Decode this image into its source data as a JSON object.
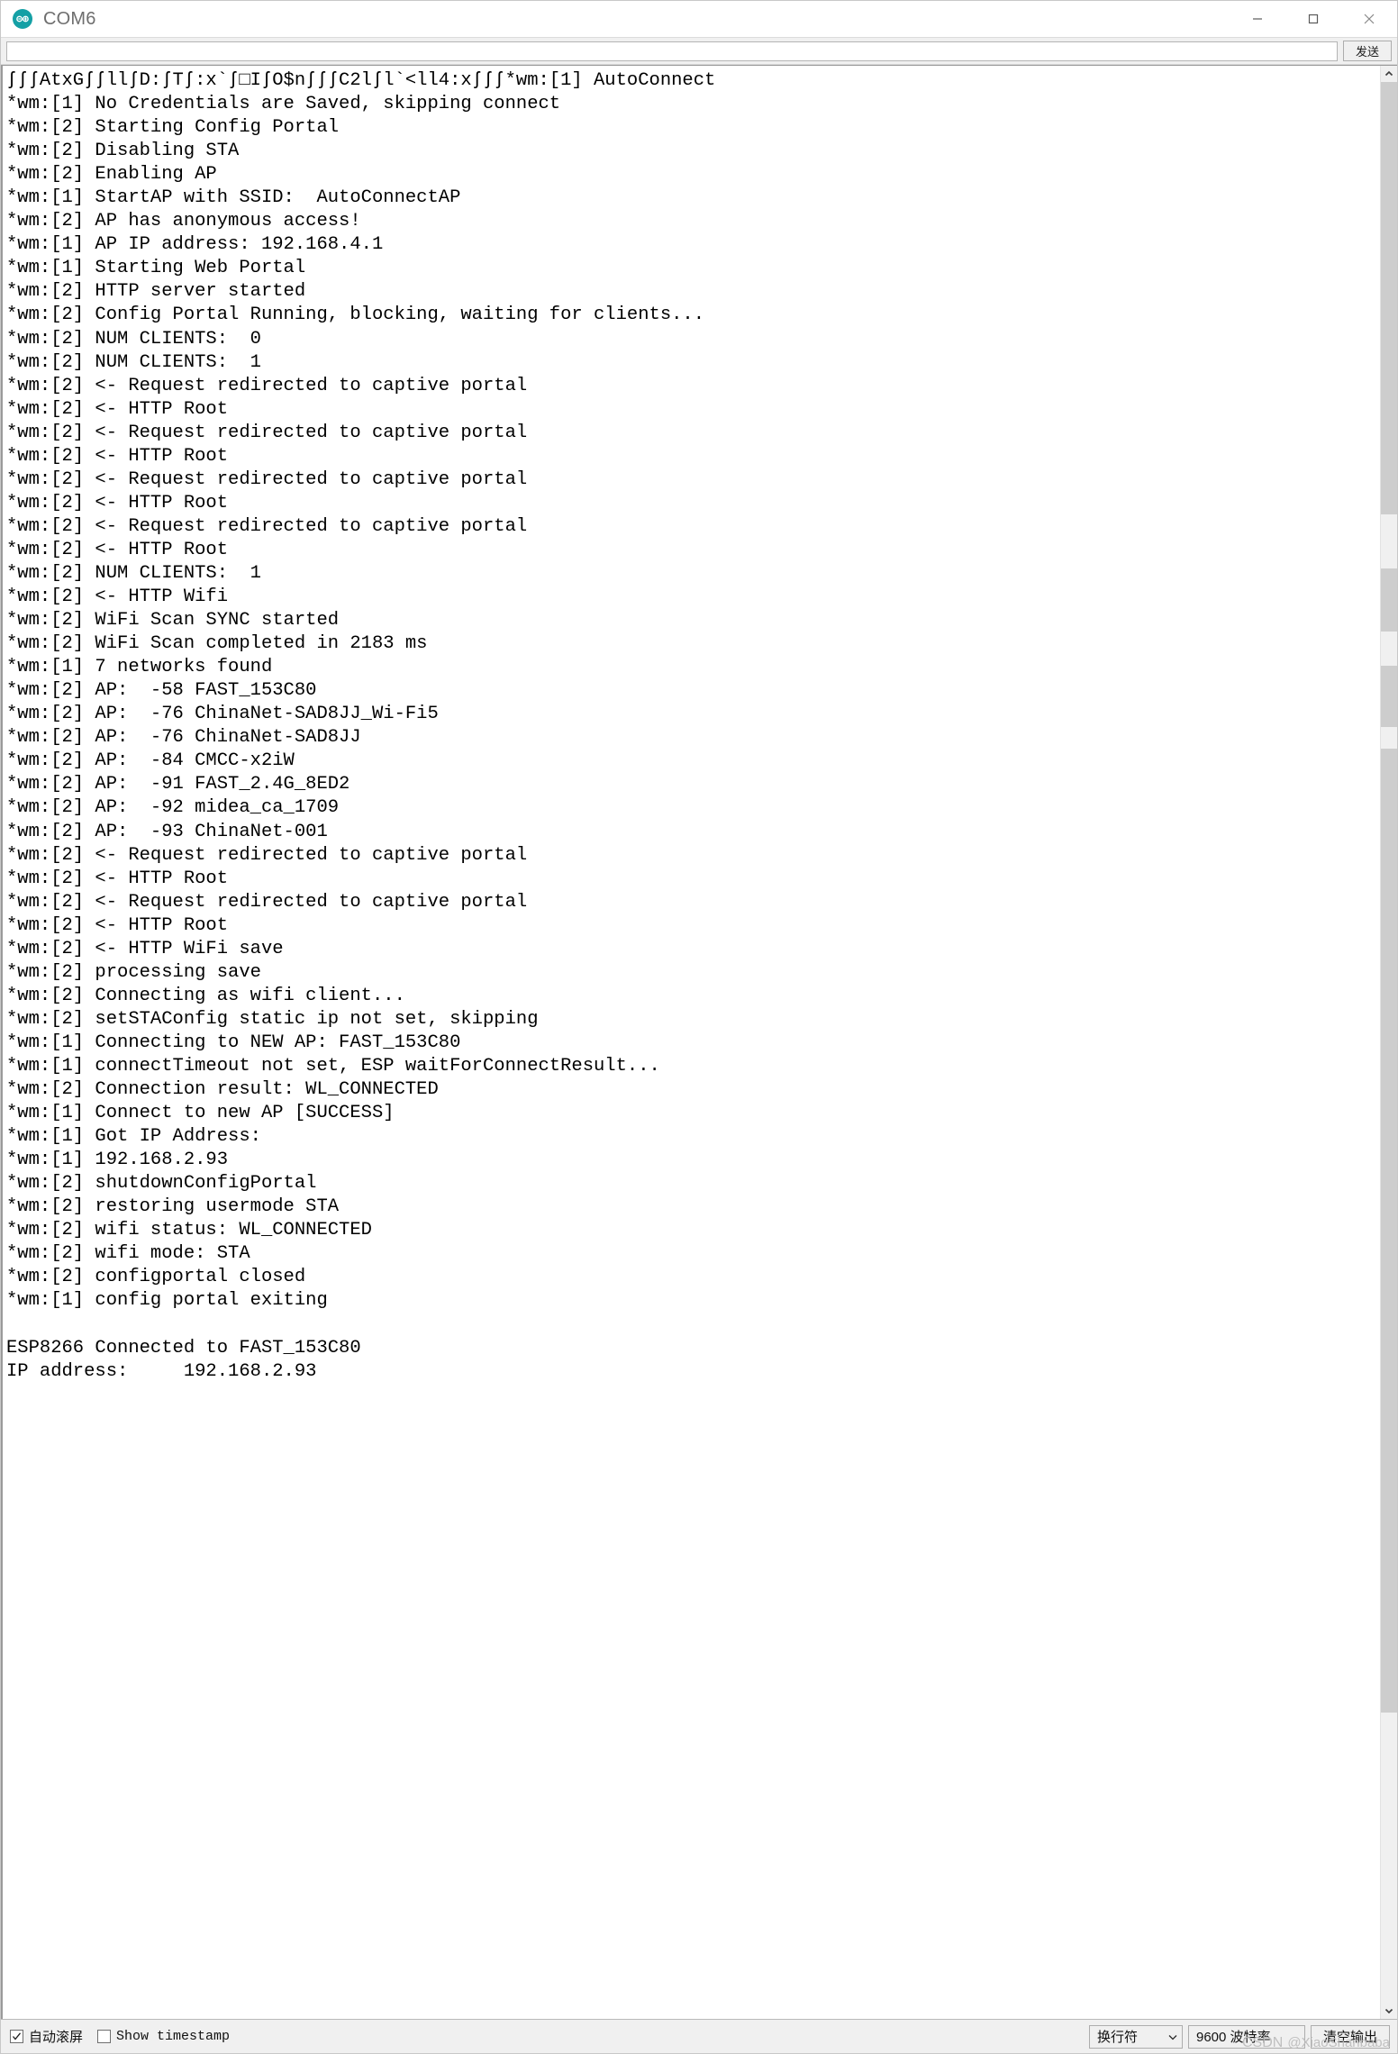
{
  "window": {
    "title": "COM6",
    "logo_icon": "arduino-logo-icon",
    "controls": [
      {
        "name": "minimize-button",
        "icon": "minimize-icon"
      },
      {
        "name": "maximize-button",
        "icon": "maximize-icon"
      },
      {
        "name": "close-button",
        "icon": "close-icon"
      }
    ]
  },
  "send_row": {
    "input_value": "",
    "input_placeholder": "",
    "send_label": "发送"
  },
  "console": {
    "lines": [
      "ʃʃʃAtxGʃʃllʃD:ʃTʃ:x`ʃ□IʃO$nʃʃʃC2lʃl`<ll4:xʃʃʃ*wm:[1] AutoConnect",
      "*wm:[1] No Credentials are Saved, skipping connect",
      "*wm:[2] Starting Config Portal",
      "*wm:[2] Disabling STA",
      "*wm:[2] Enabling AP",
      "*wm:[1] StartAP with SSID:  AutoConnectAP",
      "*wm:[2] AP has anonymous access!",
      "*wm:[1] AP IP address: 192.168.4.1",
      "*wm:[1] Starting Web Portal",
      "*wm:[2] HTTP server started",
      "*wm:[2] Config Portal Running, blocking, waiting for clients...",
      "*wm:[2] NUM CLIENTS:  0",
      "*wm:[2] NUM CLIENTS:  1",
      "*wm:[2] <- Request redirected to captive portal",
      "*wm:[2] <- HTTP Root",
      "*wm:[2] <- Request redirected to captive portal",
      "*wm:[2] <- HTTP Root",
      "*wm:[2] <- Request redirected to captive portal",
      "*wm:[2] <- HTTP Root",
      "*wm:[2] <- Request redirected to captive portal",
      "*wm:[2] <- HTTP Root",
      "*wm:[2] NUM CLIENTS:  1",
      "*wm:[2] <- HTTP Wifi",
      "*wm:[2] WiFi Scan SYNC started",
      "*wm:[2] WiFi Scan completed in 2183 ms",
      "*wm:[1] 7 networks found",
      "*wm:[2] AP:  -58 FAST_153C80",
      "*wm:[2] AP:  -76 ChinaNet-SAD8JJ_Wi-Fi5",
      "*wm:[2] AP:  -76 ChinaNet-SAD8JJ",
      "*wm:[2] AP:  -84 CMCC-x2iW",
      "*wm:[2] AP:  -91 FAST_2.4G_8ED2",
      "*wm:[2] AP:  -92 midea_ca_1709",
      "*wm:[2] AP:  -93 ChinaNet-001",
      "*wm:[2] <- Request redirected to captive portal",
      "*wm:[2] <- HTTP Root",
      "*wm:[2] <- Request redirected to captive portal",
      "*wm:[2] <- HTTP Root",
      "*wm:[2] <- HTTP WiFi save",
      "*wm:[2] processing save",
      "*wm:[2] Connecting as wifi client...",
      "*wm:[2] setSTAConfig static ip not set, skipping",
      "*wm:[1] Connecting to NEW AP: FAST_153C80",
      "*wm:[1] connectTimeout not set, ESP waitForConnectResult...",
      "*wm:[2] Connection result: WL_CONNECTED",
      "*wm:[1] Connect to new AP [SUCCESS]",
      "*wm:[1] Got IP Address:",
      "*wm:[1] 192.168.2.93",
      "*wm:[2] shutdownConfigPortal",
      "*wm:[2] restoring usermode STA",
      "*wm:[2] wifi status: WL_CONNECTED",
      "*wm:[2] wifi mode: STA",
      "*wm:[2] configportal closed",
      "*wm:[1] config portal exiting",
      "",
      "ESP8266 Connected to FAST_153C80",
      "IP address:     192.168.2.93"
    ]
  },
  "scrollbar": {
    "up_arrow_icon": "chevron-up-icon",
    "down_arrow_icon": "chevron-down-icon"
  },
  "bottom_bar": {
    "autoscroll": {
      "label": "自动滚屏",
      "checked": true
    },
    "show_timestamp": {
      "label": "Show timestamp",
      "checked": false
    },
    "eol_select": {
      "value": "换行符",
      "caret_icon": "chevron-down-icon"
    },
    "baud_select": {
      "value": "9600 波特率"
    },
    "clear_button": {
      "label": "清空输出"
    },
    "watermark": {
      "brand": "CSDN",
      "user": "@XiaoShanbaba"
    }
  },
  "colors": {
    "accent": "#14a0a5",
    "window_bg": "#ffffff",
    "chrome_bg": "#f0f0f0",
    "text": "#000000",
    "title_text": "#6e6e6e",
    "scroll_thumb": "#cdcdcd"
  }
}
